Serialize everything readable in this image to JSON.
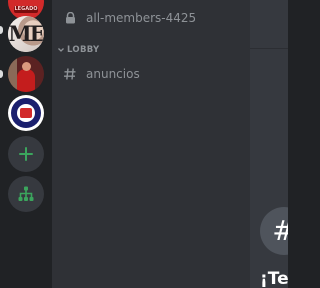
{
  "servers": [
    {
      "name": "server-1",
      "banner_text": "LEGADO"
    },
    {
      "name": "server-2",
      "logo_text": "ME"
    },
    {
      "name": "server-3"
    },
    {
      "name": "server-4"
    }
  ],
  "rail": {
    "add_server_icon": "plus-icon",
    "explore_icon": "hierarchy-icon",
    "accent_color": "#3ba55d"
  },
  "channels": {
    "locked": {
      "label": "all-members-4425",
      "icon": "lock-icon"
    },
    "category": {
      "label": "LOBBY",
      "icon": "chevron-down-icon"
    },
    "items": [
      {
        "label": "anuncios",
        "icon": "hash-icon"
      }
    ]
  },
  "chat": {
    "welcome_hash": "#",
    "welcome_title": "¡Te"
  },
  "colors": {
    "rail_bg": "#202225",
    "sidebar_bg": "#2f3136",
    "chat_bg": "#36393f",
    "muted_text": "#8e9297"
  }
}
